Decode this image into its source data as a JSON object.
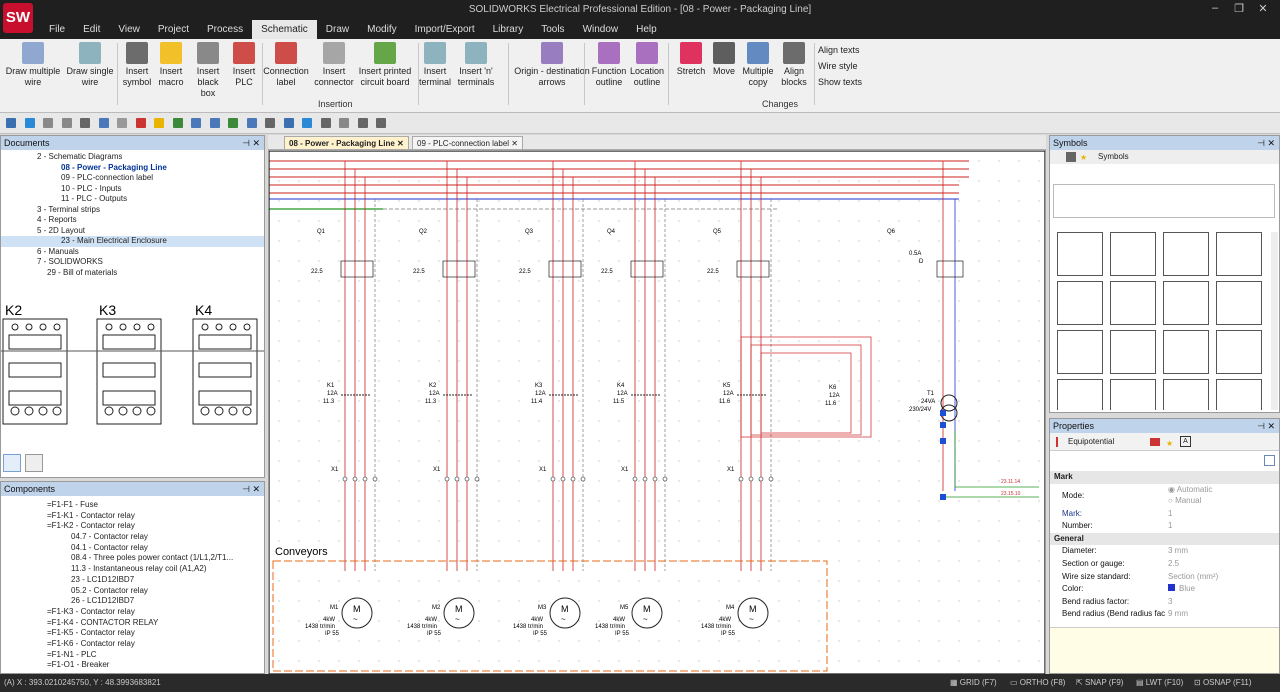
{
  "window": {
    "title": "SOLIDWORKS Electrical Professional Edition - [08 - Power - Packaging Line]",
    "logo": "SW"
  },
  "menu": [
    "File",
    "Edit",
    "View",
    "Project",
    "Process",
    "Schematic",
    "Draw",
    "Modify",
    "Import/Export",
    "Library",
    "Tools",
    "Window",
    "Help"
  ],
  "ribbon": {
    "buttons": [
      {
        "label": "Draw multiple wire",
        "icon": "multi-wire-icon"
      },
      {
        "label": "Draw single wire",
        "icon": "single-wire-icon"
      },
      {
        "label": "Insert symbol",
        "icon": "symbol-icon"
      },
      {
        "label": "Insert macro",
        "icon": "macro-star-icon"
      },
      {
        "label": "Insert black box",
        "icon": "black-box-icon"
      },
      {
        "label": "Insert PLC",
        "icon": "plc-icon"
      },
      {
        "label": "Connection label",
        "icon": "connection-label-icon"
      },
      {
        "label": "Insert connector",
        "icon": "connector-icon"
      },
      {
        "label": "Insert printed circuit board",
        "icon": "pcb-icon"
      },
      {
        "label": "Insert terminal",
        "icon": "terminal-icon"
      },
      {
        "label": "Insert 'n' terminals",
        "icon": "n-terminals-icon"
      },
      {
        "label": "Origin - destination arrows",
        "icon": "origin-arrows-icon"
      },
      {
        "label": "Function outline",
        "icon": "function-outline-icon"
      },
      {
        "label": "Location outline",
        "icon": "location-outline-icon"
      },
      {
        "label": "Stretch",
        "icon": "stretch-icon"
      },
      {
        "label": "Move",
        "icon": "move-icon"
      },
      {
        "label": "Multiple copy",
        "icon": "multiple-copy-icon"
      },
      {
        "label": "Align blocks",
        "icon": "align-blocks-icon"
      }
    ],
    "groups": {
      "insertion": "Insertion",
      "changes": "Changes"
    },
    "small": [
      "Align texts",
      "Wire style",
      "Show texts"
    ]
  },
  "documents": {
    "header": "Documents",
    "items": [
      "2 - Schematic Diagrams",
      "08 - Power - Packaging Line",
      "09 - PLC-connection label",
      "10 - PLC - Inputs",
      "11 - PLC - Outputs",
      "3 - Terminal strips",
      "4 - Reports",
      "5 - 2D Layout",
      "23 - Main Electrical Enclosure",
      "6 - Manuals",
      "7 - SOLIDWORKS",
      "29 - Bill of materials"
    ],
    "preview_labels": [
      "K2",
      "K3",
      "K4"
    ]
  },
  "components": {
    "header": "Components",
    "items": [
      "=F1-F1 - Fuse",
      "=F1-K1 - Contactor relay",
      "=F1-K2 - Contactor relay",
      "04.7 - Contactor relay",
      "04.1 - Contactor relay",
      "08.4 - Three poles power contact (1/L1,2/T1...",
      "11.3 - Instantaneous relay coil (A1,A2)",
      "23 - LC1D12IBD7",
      "05.2 - Contactor relay",
      "26 - LC1D12IBD7",
      "=F1-K3 - Contactor relay",
      "=F1-K4 - CONTACTOR RELAY",
      "=F1-K5 - Contactor relay",
      "=F1-K6 - Contactor relay",
      "=F1-N1 - PLC",
      "=F1-O1 - Breaker"
    ]
  },
  "tabs": [
    "08 - Power - Packaging Line",
    "09 - PLC-connection label"
  ],
  "schematic": {
    "breakers": [
      "Q1",
      "Q2",
      "Q3",
      "Q4",
      "Q5",
      "Q6"
    ],
    "breaker_rating": "22.5",
    "q6_rating": "0.5A",
    "q6_sub": "D",
    "contactors": [
      {
        "n": "K1",
        "a": "12A",
        "r": "11.3"
      },
      {
        "n": "K2",
        "a": "12A",
        "r": "11.3"
      },
      {
        "n": "K3",
        "a": "12A",
        "r": "11.4"
      },
      {
        "n": "K4",
        "a": "12A",
        "r": "11.5"
      },
      {
        "n": "K5",
        "a": "12A",
        "r": "11.6"
      },
      {
        "n": "K6",
        "a": "12A",
        "r": "11.6"
      }
    ],
    "transformer": {
      "name": "T1",
      "va": "24VA",
      "v": "230/24V"
    },
    "terminal": "X1",
    "section": "Conveyors",
    "motors": [
      {
        "n": "M1",
        "p": "4kW",
        "s": "1438 tr/min",
        "ip": "IP 55"
      },
      {
        "n": "M2",
        "p": "4kW",
        "s": "1438 tr/min",
        "ip": "IP 55"
      },
      {
        "n": "M3",
        "p": "4kW",
        "s": "1438 tr/min",
        "ip": "IP 55"
      },
      {
        "n": "M5",
        "p": "4kW",
        "s": "1438 tr/min",
        "ip": "IP 55"
      },
      {
        "n": "M4",
        "p": "4kW",
        "s": "1438 tr/min",
        "ip": "IP 55"
      }
    ],
    "refs": [
      "23.11.14",
      "23.15.10"
    ]
  },
  "symbols": {
    "header": "Symbols",
    "tab": "Symbols"
  },
  "properties": {
    "header": "Properties",
    "tab": "Equipotential",
    "mark_section": "Mark",
    "mode_label": "Mode:",
    "mode_options": [
      "Automatic",
      "Manual"
    ],
    "mark_label": "Mark:",
    "mark_value": "1",
    "number_label": "Number:",
    "number_value": "1",
    "general_section": "General",
    "rows": [
      {
        "k": "Diameter:",
        "v": "3 mm"
      },
      {
        "k": "Section or gauge:",
        "v": "2.5"
      },
      {
        "k": "Wire size standard:",
        "v": "Section (mm²)"
      },
      {
        "k": "Color:",
        "v": "Blue"
      },
      {
        "k": "Bend radius factor:",
        "v": "3"
      },
      {
        "k": "Bend radius (Bend radius fac",
        "v": "9 mm"
      }
    ]
  },
  "status": {
    "coords": "(A) X : 393.0210245750, Y : 48.3993683821",
    "grid": "GRID (F7)",
    "ortho": "ORTHO (F8)",
    "snap": "SNAP (F9)",
    "lwt": "LWT (F10)",
    "osnap": "OSNAP (F11)"
  },
  "colors": {
    "wire_red": "#cc2222",
    "wire_blue": "#2233cc",
    "wire_green": "#229922",
    "accent": "#bfd3ea"
  }
}
